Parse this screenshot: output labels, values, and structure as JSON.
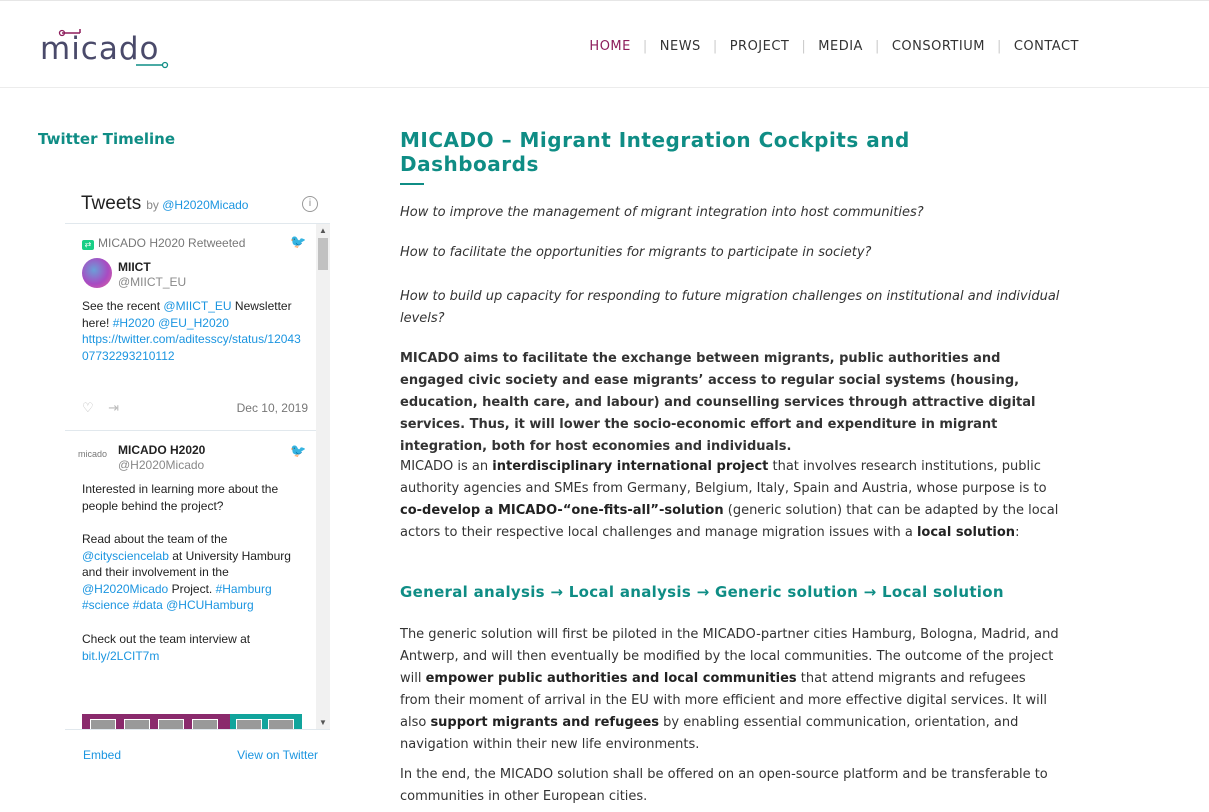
{
  "header": {
    "logo_text": "micado",
    "nav": [
      {
        "label": "HOME",
        "active": true
      },
      {
        "label": "NEWS",
        "active": false
      },
      {
        "label": "PROJECT",
        "active": false
      },
      {
        "label": "MEDIA",
        "active": false
      },
      {
        "label": "CONSORTIUM",
        "active": false
      },
      {
        "label": "CONTACT",
        "active": false
      }
    ],
    "nav_separator": "|"
  },
  "sidebar": {
    "title": "Twitter Timeline",
    "widget": {
      "heading": "Tweets",
      "by_prefix": "by",
      "by_handle": "@H2020Micado",
      "info_icon": "i",
      "tweets": [
        {
          "retweet_label": "MICADO H2020 Retweeted",
          "name": "MIICT",
          "handle": "@MIICT_EU",
          "text_parts": [
            "See the recent ",
            "@MIICT_EU",
            " Newsletter here! ",
            "#H2020",
            " ",
            "@EU_H2020",
            " ",
            "https://twitter.com/aditesscy/status/1204307732293210112"
          ],
          "date": "Dec 10, 2019"
        },
        {
          "name": "MICADO H2020",
          "handle": "@H2020Micado",
          "avatar_text": "micado",
          "para1": "Interested in learning more about the people behind the project?",
          "para2_parts": [
            "Read about the team of the ",
            "@citysciencelab",
            " at University Hamburg and their involvement in the ",
            "@H2020Micado",
            " Project. ",
            "#Hamburg",
            " ",
            "#science",
            " ",
            "#data",
            " ",
            "@HCUHamburg"
          ],
          "para3_prefix": "Check out the team interview at",
          "para3_link": "bit.ly/2LCIT7m"
        }
      ],
      "footer_embed": "Embed",
      "footer_view": "View on Twitter"
    }
  },
  "main": {
    "title": "MICADO – Migrant Integration Cockpits and Dashboards",
    "q1": "How to improve the management of migrant integration into host communities?",
    "q2": "How to facilitate the opportunities for migrants to participate in society?",
    "q3": "How to build up capacity for responding to future migration challenges on institutional and individual levels?",
    "aims": "MICADO aims to facilitate the exchange between migrants, public authorities and engaged civic society and ease migrants’ access to regular social systems (housing, education, health care, and labour) and counselling services through attractive digital services. Thus, it will lower the socio-economic effort and expenditure in migrant integration, both for host economies and individuals.",
    "p2": {
      "a": "MICADO is an ",
      "b": "interdisciplinary international project",
      "c": " that involves research institutions, public authority agencies and SMEs from Germany, Belgium, Italy, Spain and Austria, whose purpose is to ",
      "d": "co-develop a MICADO-“one-fits-all”-solution",
      "e": " (generic solution) that can be adapted by the local actors to their respective local challenges and manage migration issues with a ",
      "f": "local solution",
      "g": ":"
    },
    "subheading": "General analysis  → Local analysis →   Generic solution → Local solution",
    "p3": {
      "a": "The generic solution will first be piloted in the MICADO-partner cities Hamburg, Bologna, Madrid, and Antwerp, and will then eventually be modified by the local communities. The outcome of the project will ",
      "b": "empower public authorities and local communities",
      "c": " that attend migrants and refugees from their moment of arrival in the EU with more efficient and more effective digital services. It will also ",
      "d": "support migrants and refugees",
      "e": " by enabling essential communication, orientation, and navigation within their new life environments."
    },
    "p4": "In the end, the MICADO solution shall be offered on an open-source platform and be transferable to communities in other European cities."
  },
  "colors": {
    "accent": "#0f8d85",
    "active_nav": "#8d1d5c",
    "link": "#1b95e0"
  }
}
